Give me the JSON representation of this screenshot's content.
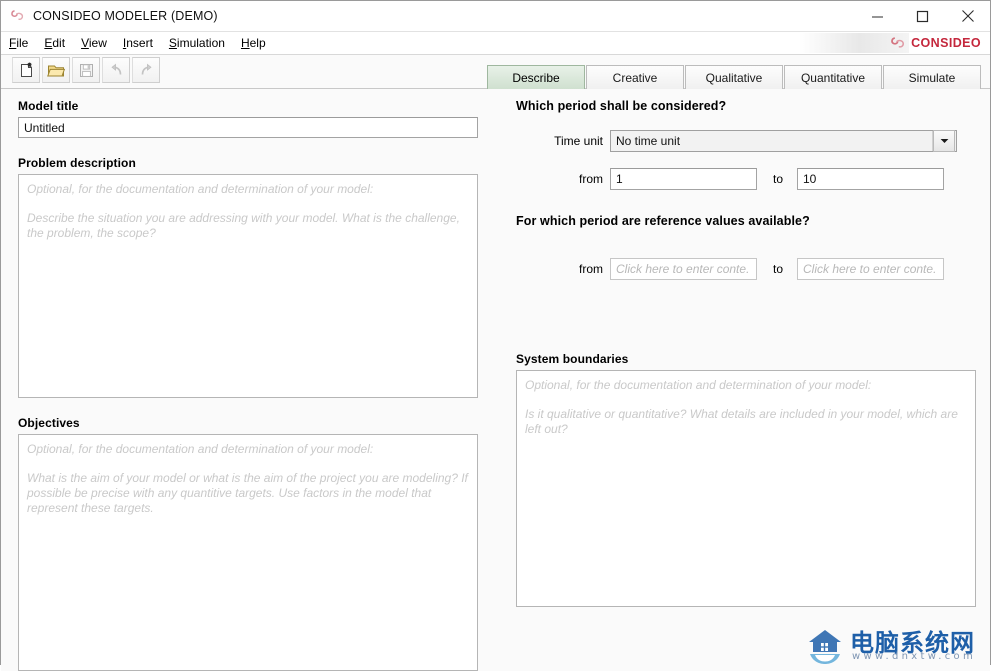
{
  "window": {
    "title": "CONSIDEO MODELER (DEMO)",
    "app_icon": "consideo-swirl-icon",
    "controls": {
      "minimize": "minimize-icon",
      "maximize": "maximize-icon",
      "close": "close-icon"
    }
  },
  "brand": {
    "text": "CONSIDEO",
    "mark": "consideo-swirl-icon",
    "color": "#c4273c"
  },
  "menu": {
    "items": [
      {
        "label": "File",
        "accel": "F"
      },
      {
        "label": "Edit",
        "accel": "E"
      },
      {
        "label": "View",
        "accel": "V"
      },
      {
        "label": "Insert",
        "accel": "I"
      },
      {
        "label": "Simulation",
        "accel": "S"
      },
      {
        "label": "Help",
        "accel": "H"
      }
    ]
  },
  "toolbar": {
    "buttons": [
      {
        "name": "new-model-button",
        "icon": "new-document-icon",
        "enabled": true
      },
      {
        "name": "open-model-button",
        "icon": "open-folder-icon",
        "enabled": true
      },
      {
        "name": "save-model-button",
        "icon": "save-disk-icon",
        "enabled": false
      },
      {
        "name": "undo-button",
        "icon": "undo-arrow-icon",
        "enabled": false
      },
      {
        "name": "redo-button",
        "icon": "redo-arrow-icon",
        "enabled": false
      }
    ]
  },
  "tabs": {
    "active": "Describe",
    "items": [
      {
        "label": "Describe"
      },
      {
        "label": "Creative"
      },
      {
        "label": "Qualitative"
      },
      {
        "label": "Quantitative"
      },
      {
        "label": "Simulate"
      }
    ]
  },
  "left": {
    "model_title": {
      "label": "Model title",
      "value": "Untitled"
    },
    "problem_description": {
      "label": "Problem description",
      "value": "",
      "placeholder_lines": [
        "Optional, for the documentation and determination of your model:",
        "Describe the situation you are addressing with your model. What is the challenge, the problem, the scope?"
      ]
    },
    "objectives": {
      "label": "Objectives",
      "value": "",
      "placeholder_lines": [
        "Optional, for the documentation and determination of your model:",
        "What is the aim of your model or what is the aim of the project you are modeling? If possible be precise with any quantitive targets. Use factors in the model that represent these targets."
      ]
    }
  },
  "right": {
    "period_section": {
      "heading": "Which period shall be considered?",
      "time_unit": {
        "label": "Time unit",
        "value": "No time unit",
        "options": [
          "No time unit"
        ]
      },
      "from": {
        "label": "from",
        "value": "1"
      },
      "to": {
        "label": "to",
        "value": "10"
      }
    },
    "reference_section": {
      "heading": "For which period are reference values available?",
      "from": {
        "label": "from",
        "value": "",
        "placeholder": "Click here to enter conte."
      },
      "to": {
        "label": "to",
        "value": "",
        "placeholder": "Click here to enter conte."
      }
    },
    "system_boundaries": {
      "label": "System boundaries",
      "value": "",
      "placeholder_lines": [
        "Optional, for the documentation and determination of your model:",
        "Is it qualitative or quantitative? What details are included in your model, which are left out?"
      ]
    }
  },
  "watermark": {
    "cn_text": "电脑系统网",
    "url_text": "www.dnxtw.com",
    "icon": "house-logo-icon",
    "color": "#1e5fa8"
  }
}
